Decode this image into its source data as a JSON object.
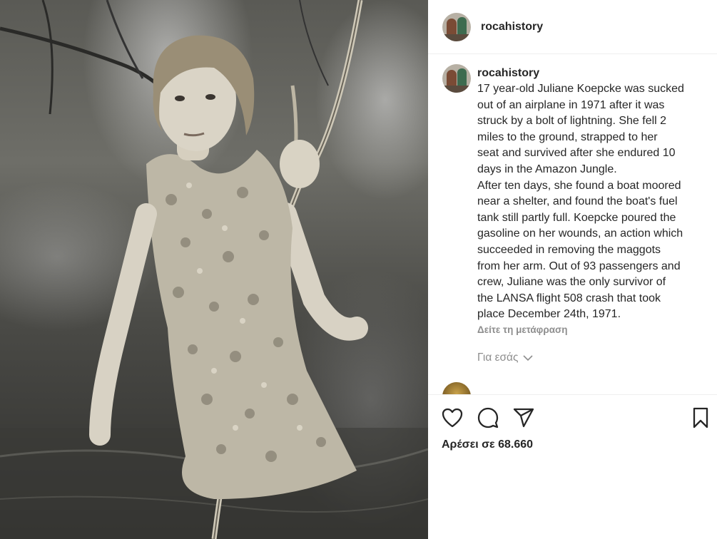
{
  "post": {
    "image": {
      "description_icon": "photo-icon"
    },
    "header": {
      "username": "rocahistory"
    },
    "caption": {
      "username": "rocahistory",
      "text": "17 year-old Juliane Koepcke was sucked\nout of an airplane in 1971 after it was\nstruck by a bolt of lightning. She fell 2\nmiles to the ground, strapped to her\nseat and survived after she endured 10\ndays in the Amazon Jungle.\nAfter ten days, she found a boat moored\nnear a shelter, and found the boat's fuel\ntank still partly full. Koepcke poured the\ngasoline on her wounds, an action which\nsucceeded in removing the maggots\nfrom her arm. Out of 93 passengers and\ncrew, Juliane was the only survivor of\nthe LANSA flight 508 crash that took\nplace December 24th, 1971.",
      "translate_label": "Δείτε τη μετάφραση"
    },
    "for_you_label": "Για εσάς",
    "actions": {
      "like_icon": "heart-icon",
      "comment_icon": "speech-bubble-icon",
      "share_icon": "paper-plane-icon",
      "save_icon": "bookmark-icon"
    },
    "likes_text": "Αρέσει σε 68.660"
  },
  "colors": {
    "text": "#262626",
    "secondary": "#8e8e8e",
    "divider": "#efefef"
  }
}
